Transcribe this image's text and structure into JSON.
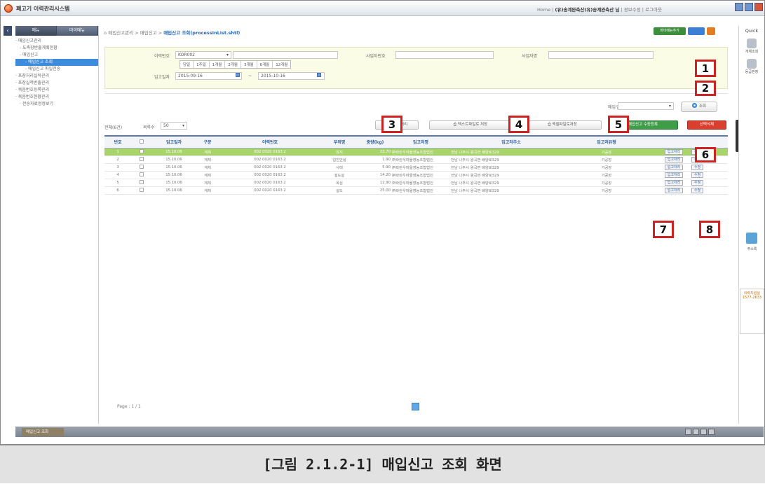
{
  "app": {
    "title": "폐고기 이력관리시스템",
    "top_links": [
      "Home",
      "(유)송계완축산(유)송계완축산 님",
      "정보수정",
      "로그아웃"
    ]
  },
  "sidebar": {
    "tab_menu": "메뉴",
    "tab_mymenu": "마이메뉴",
    "items": [
      "· 매입신고관리",
      "- 도축장반출계획현황",
      "- 매입신고",
      "- 매입신고 조회",
      "- 매입신고 파일전송",
      "· 포장처리실적관리",
      "· 포장실적반출관리",
      "· 묶음번호등록관리",
      "· 묶음번호현황관리",
      "· 전송자료정정보기"
    ]
  },
  "breadcrumb": {
    "path": "매입신고관리 > 매입신고 > ",
    "current": "매입신고 조회(processInList.shtl)",
    "fav_label": "마이메뉴추가"
  },
  "filter": {
    "trace_label": "이력번호",
    "trace_value": "KOR002",
    "bizno_label": "사업자번호",
    "bizname_label": "사업자명",
    "date_label": "입고일자",
    "periods": [
      "당일",
      "1주일",
      "1개월",
      "2개월",
      "3개월",
      "6개월",
      "12개월"
    ],
    "date_from": "2015-09-16",
    "date_to": "2015-10-16",
    "range_sep": "~",
    "search_label": "조회",
    "type_label": "매입구분"
  },
  "actions": {
    "bulk": "일괄입고처리",
    "text_save": "텍스트파일로 저장",
    "excel_save": "엑셀파일로저장",
    "manual_reg": "매입신고 수동등록",
    "delete_sel": "선택삭제",
    "total": "전체(6건)",
    "rows_label": "목록수",
    "rows_value": "50"
  },
  "table": {
    "headers": [
      "번호",
      "",
      "입고일자",
      "구분",
      "이력번호",
      "부위명",
      "중량(kg)",
      "입고처명",
      "입고처주소",
      "입고처유형",
      ""
    ],
    "rows": [
      [
        "1",
        "15.10.06",
        "계체",
        "002 0020 0163 2",
        "양지",
        "23.70",
        "㈜락란우마을영농조합법인",
        "전남 나주시 왕곡면 배양로329",
        "가공장"
      ],
      [
        "2",
        "15.10.06",
        "계체",
        "002 0020 0163 2",
        "업진안살",
        "1.90",
        "㈜락란우마을영농조합법인",
        "전남 나주시 왕곡면 배양로329",
        "가공장"
      ],
      [
        "3",
        "15.10.06",
        "계체",
        "002 0020 0163 2",
        "사태",
        "5.90",
        "㈜락란우마을영농조합법인",
        "전남 나주시 왕곡면 배양로329",
        "가공장"
      ],
      [
        "4",
        "15.10.06",
        "계체",
        "002 0020 0163 2",
        "설도살",
        "14.20",
        "㈜락란우마을영농조합법인",
        "전남 나주시 왕곡면 배양로329",
        "가공장"
      ],
      [
        "5",
        "15.10.06",
        "계체",
        "002 0020 0163 2",
        "목심",
        "12.90",
        "㈜락란우마을영농조합법인",
        "전남 나주시 왕곡면 배양로329",
        "가공장"
      ],
      [
        "6",
        "15.10.06",
        "계체",
        "002 0020 0163 2",
        "설도",
        "25.00",
        "㈜락란우마을영농조합법인",
        "전남 나주시 왕곡면 배양로329",
        "가공장"
      ]
    ],
    "row_btn1": "입고처리",
    "row_btn2": "수정"
  },
  "paging": {
    "text": "Page : 1 / 1"
  },
  "callouts": [
    "1",
    "2",
    "3",
    "4",
    "5",
    "6",
    "7",
    "8"
  ],
  "quick": {
    "title": "Quick",
    "item1": "개체조회",
    "item2": "등급판정",
    "call": "주소록",
    "help": "이력지원실 1577-2633"
  },
  "taskbar": {
    "tab": "매입신고 조회"
  },
  "caption": "[그림 2.1.2-1] 매입신고 조회 화면"
}
